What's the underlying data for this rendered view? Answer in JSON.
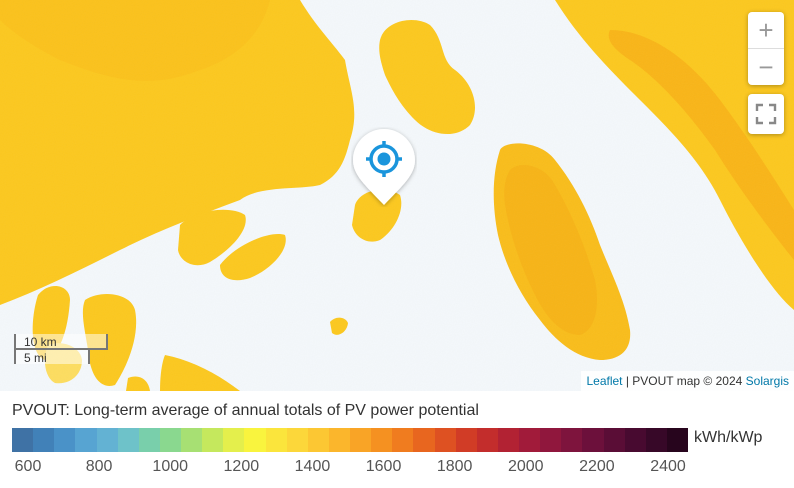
{
  "map": {
    "controls": {
      "zoom_in": "+",
      "zoom_out": "−",
      "fullscreen_icon": "fullscreen-icon"
    },
    "marker_icon": "crosshair-location-icon",
    "scale": {
      "km_label": "10 km",
      "mi_label": "5 mi"
    },
    "attribution": {
      "leaflet": "Leaflet",
      "separator": " | ",
      "middle": "PVOUT map © 2024 ",
      "solargis": "Solargis"
    },
    "colors": {
      "water": "#f4f8fb",
      "land_primary": "#fcc81e",
      "land_secondary": "#f9b81a",
      "marker_blue": "#1a95dc"
    }
  },
  "legend": {
    "title": "PVOUT: Long-term average of annual totals of PV power potential",
    "unit": "kWh/kWp",
    "tick_labels": [
      "600",
      "800",
      "1000",
      "1200",
      "1400",
      "1600",
      "1800",
      "2000",
      "2200",
      "2400"
    ],
    "color_steps": [
      "#3f72a5",
      "#4181b8",
      "#4a92c8",
      "#57a4d2",
      "#63b2d3",
      "#6ec2c9",
      "#79cfab",
      "#8ad88f",
      "#a7e073",
      "#c5e85d",
      "#e4ef4c",
      "#f9f43e",
      "#fbe53c",
      "#fcd73a",
      "#fcc733",
      "#fbb62c",
      "#f9a426",
      "#f59121",
      "#f07c1f",
      "#e8661f",
      "#de5122",
      "#d13c26",
      "#c32d2c",
      "#b22233",
      "#a11b3a",
      "#90173d",
      "#7e143d",
      "#6c103b",
      "#5a0d36",
      "#480a30",
      "#370828",
      "#27051d"
    ]
  }
}
